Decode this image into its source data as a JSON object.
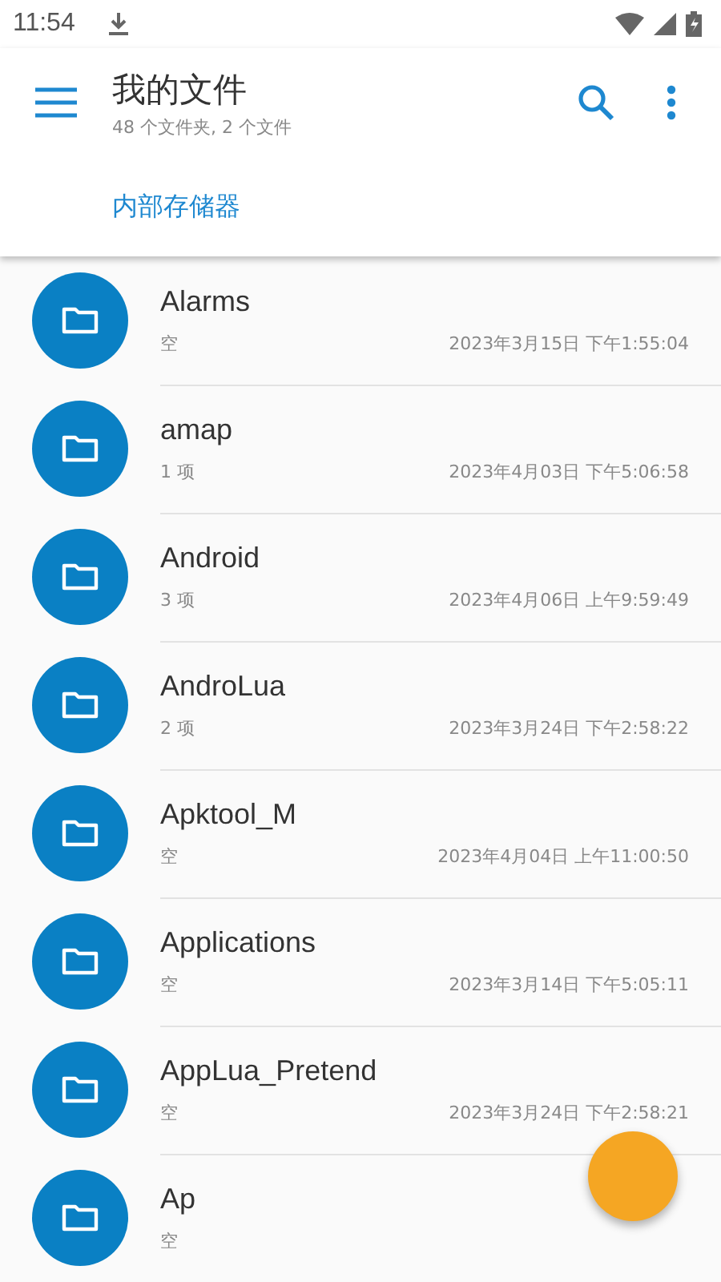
{
  "status_bar": {
    "time": "11:54"
  },
  "toolbar": {
    "title": "我的文件",
    "subtitle": "48 个文件夹, 2 个文件"
  },
  "breadcrumb": {
    "label": "内部存储器"
  },
  "folders": [
    {
      "name": "Alarms",
      "info": "空",
      "date": "2023年3月15日 下午1:55:04"
    },
    {
      "name": "amap",
      "info": "1 项",
      "date": "2023年4月03日 下午5:06:58"
    },
    {
      "name": "Android",
      "info": "3 项",
      "date": "2023年4月06日 上午9:59:49"
    },
    {
      "name": "AndroLua",
      "info": "2 项",
      "date": "2023年3月24日 下午2:58:22"
    },
    {
      "name": "Apktool_M",
      "info": "空",
      "date": "2023年4月04日 上午11:00:50"
    },
    {
      "name": "Applications",
      "info": "空",
      "date": "2023年3月14日 下午5:05:11"
    },
    {
      "name": "AppLua_Pretend",
      "info": "空",
      "date": "2023年3月24日 下午2:58:21"
    },
    {
      "name": "Ap",
      "info": "空"
    }
  ]
}
